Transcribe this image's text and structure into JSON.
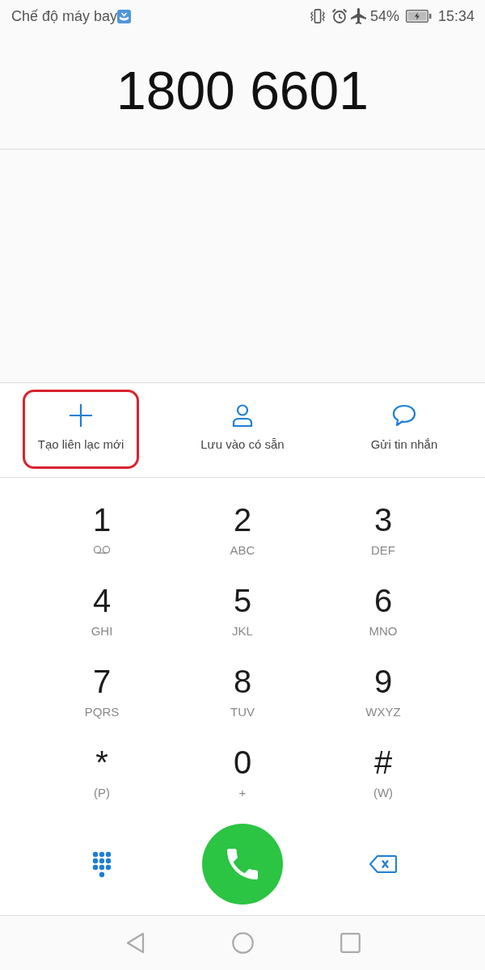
{
  "status_bar": {
    "mode_label": "Chế độ máy bay",
    "battery_text": "54%",
    "time": "15:34"
  },
  "dialed_number": "1800 6601",
  "actions": [
    {
      "kind": "new_contact",
      "label": "Tạo liên lạc mới",
      "highlighted": true
    },
    {
      "kind": "save_existing",
      "label": "Lưu vào có sẵn",
      "highlighted": false
    },
    {
      "kind": "message",
      "label": "Gửi tin nhắn",
      "highlighted": false
    }
  ],
  "keys": [
    {
      "digit": "1",
      "kind": "voicemail"
    },
    {
      "digit": "2",
      "kind": "letters",
      "letters": "ABC"
    },
    {
      "digit": "3",
      "kind": "letters",
      "letters": "DEF"
    },
    {
      "digit": "4",
      "kind": "letters",
      "letters": "GHI"
    },
    {
      "digit": "5",
      "kind": "letters",
      "letters": "JKL"
    },
    {
      "digit": "6",
      "kind": "letters",
      "letters": "MNO"
    },
    {
      "digit": "7",
      "kind": "letters",
      "letters": "PQRS"
    },
    {
      "digit": "8",
      "kind": "letters",
      "letters": "TUV"
    },
    {
      "digit": "9",
      "kind": "letters",
      "letters": "WXYZ"
    },
    {
      "digit": "*",
      "kind": "letters",
      "letters": "(P)"
    },
    {
      "digit": "0",
      "kind": "letters",
      "letters": "+"
    },
    {
      "digit": "#",
      "kind": "letters",
      "letters": "(W)"
    }
  ]
}
